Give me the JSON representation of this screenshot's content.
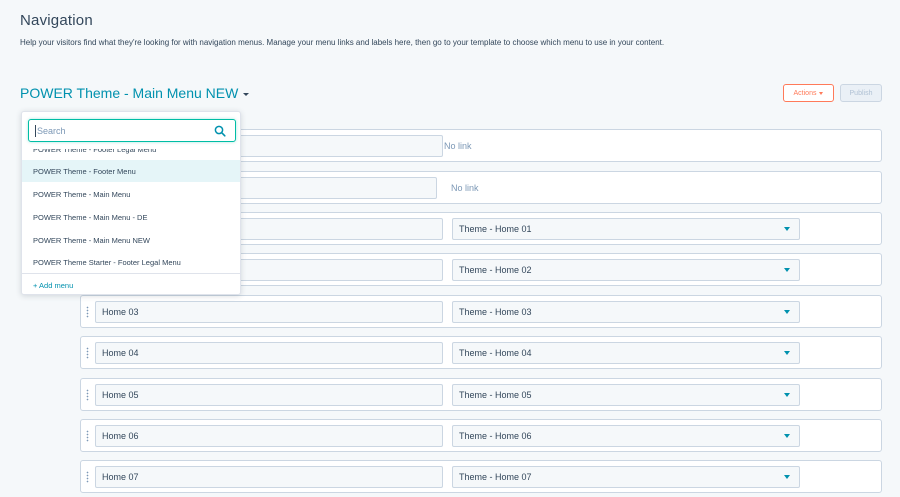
{
  "page": {
    "title": "Navigation",
    "description": "Help your visitors find what they're looking for with navigation menus. Manage your menu links and labels here, then go to your template to choose which menu to use in your content."
  },
  "menu_selector": {
    "current": "POWER Theme - Main Menu NEW",
    "icon": "caret-down-icon"
  },
  "toolbar": {
    "actions_label": "Actions",
    "publish_label": "Publish",
    "accent_color": "#ff7a59"
  },
  "dropdown": {
    "search_placeholder": "Search",
    "search_icon": "magnifier-icon",
    "items": [
      "POWER Theme - Footer Legal Menu",
      "POWER Theme - Footer Menu",
      "POWER Theme - Main Menu",
      "POWER Theme - Main Menu - DE",
      "POWER Theme - Main Menu NEW",
      "POWER Theme Starter - Footer Legal Menu"
    ],
    "highlighted_item": "POWER Theme - Footer Menu",
    "add_label": "+ Add menu"
  },
  "menu_items": {
    "row1": {
      "link": "No link"
    },
    "row2": {
      "link": "No link"
    },
    "row3": {
      "link": "Theme - Home 01"
    },
    "row4": {
      "link": "Theme - Home 02"
    },
    "row5": {
      "label": "Home 03",
      "link": "Theme - Home 03"
    },
    "row6": {
      "label": "Home 04",
      "link": "Theme - Home 04"
    },
    "row7": {
      "label": "Home 05",
      "link": "Theme - Home 05"
    },
    "row8": {
      "label": "Home 06",
      "link": "Theme - Home 06"
    },
    "row9": {
      "label": "Home 07",
      "link": "Theme - Home 07"
    }
  },
  "colors": {
    "link_blue": "#0091ae",
    "search_focus": "#00bda5",
    "text": "#33475b"
  }
}
